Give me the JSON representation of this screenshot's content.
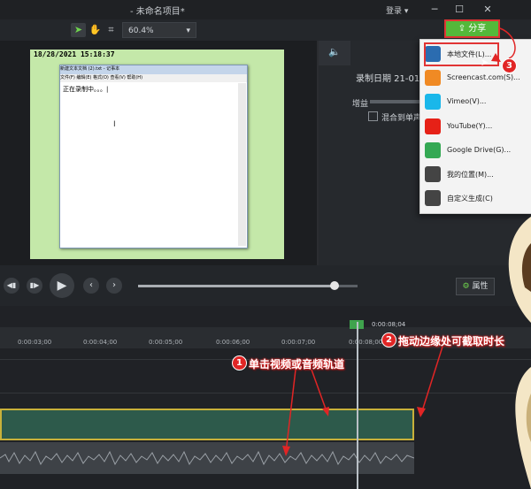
{
  "window": {
    "title": "- 未命名项目*",
    "login": "登录",
    "min": "─",
    "max": "☐",
    "close": "✕"
  },
  "toolbar": {
    "zoom": "60.4%",
    "share_label": "分享"
  },
  "canvas": {
    "timestamp": "18/28/2021 15:18:37",
    "notepad_title": "新建文本文档 (2).txt - 记事本",
    "notepad_menu": "文件(F)   编辑(E)   格式(O)   查看(V)   帮助(H)",
    "notepad_text": "正在录制中。。。|"
  },
  "properties": {
    "record_date": "录制日期 21-01-",
    "gain": "增益",
    "mix_mono": "混合到单声"
  },
  "playback": {
    "attributes": "属性"
  },
  "timeline": {
    "playhead_time": "0:00:08;04",
    "ticks": [
      "0:00:03;00",
      "0:00:04;00",
      "0:00:05;00",
      "0:00:06;00",
      "0:00:07;00",
      "0:00:08;00"
    ]
  },
  "share_menu": {
    "items": [
      {
        "label": "本地文件(L)...",
        "icon": "film-icon",
        "color": "#2b6cb0"
      },
      {
        "label": "Screencast.com(S)...",
        "icon": "screencast-icon",
        "color": "#f08a24"
      },
      {
        "label": "Vimeo(V)...",
        "icon": "vimeo-icon",
        "color": "#1ab7ea"
      },
      {
        "label": "YouTube(Y)...",
        "icon": "youtube-icon",
        "color": "#e62117"
      },
      {
        "label": "Google Drive(G)...",
        "icon": "google-drive-icon",
        "color": "#34a853"
      },
      {
        "label": "我的位置(M)...",
        "icon": "cloud-icon",
        "color": "#444444"
      },
      {
        "label": "自定义生成(C)",
        "icon": "tools-icon",
        "color": "#444444"
      }
    ]
  },
  "annotations": {
    "step1": {
      "num": "1",
      "text": "单击视频或音频轨道"
    },
    "step2": {
      "num": "2",
      "text": "拖动边缘处可截取时长"
    },
    "step3": {
      "num": "3"
    }
  },
  "colors": {
    "accent_green": "#54b83a",
    "annotation_red": "#e12525",
    "track_video": "#2d5a4b",
    "track_border": "#c8b13a"
  }
}
